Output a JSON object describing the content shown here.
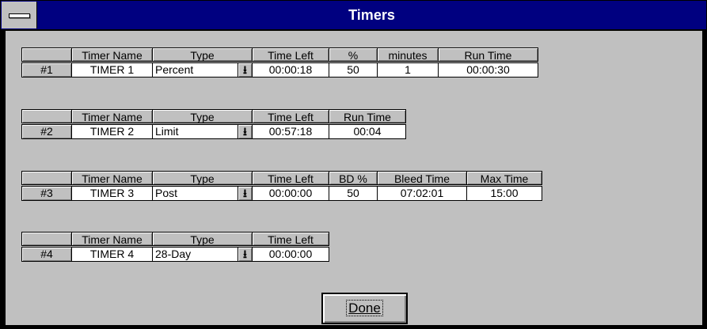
{
  "window": {
    "title": "Timers"
  },
  "tables": [
    {
      "row_label": "#1",
      "headers": [
        "Timer Name",
        "Type",
        "Time Left",
        "%",
        "minutes",
        "Run Time"
      ],
      "values": [
        "TIMER 1",
        "Percent",
        "00:00:18",
        "50",
        "1",
        "00:00:30"
      ]
    },
    {
      "row_label": "#2",
      "headers": [
        "Timer Name",
        "Type",
        "Time Left",
        "Run Time"
      ],
      "values": [
        "TIMER 2",
        "Limit",
        "00:57:18",
        "00:04"
      ]
    },
    {
      "row_label": "#3",
      "headers": [
        "Timer Name",
        "Type",
        "Time Left",
        "BD %",
        "Bleed Time",
        "Max Time"
      ],
      "values": [
        "TIMER 3",
        "Post",
        "00:00:00",
        "50",
        "07:02:01",
        "15:00"
      ]
    },
    {
      "row_label": "#4",
      "headers": [
        "Timer Name",
        "Type",
        "Time Left"
      ],
      "values": [
        "TIMER 4",
        "28-Day",
        "00:00:00"
      ]
    }
  ],
  "dropdown_icon": "arrow-down-icon",
  "done_label": "Done"
}
